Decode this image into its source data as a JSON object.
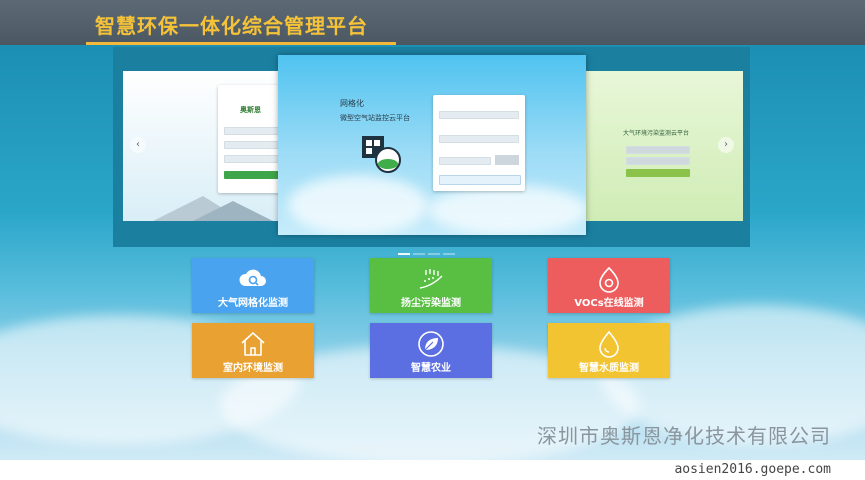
{
  "header": {
    "title": "智慧环保一体化综合管理平台"
  },
  "carousel": {
    "left_slide": {
      "brand": "奥斯恩"
    },
    "center_slide": {
      "title_line1": "网格化",
      "title_line2": "微型空气站监控云平台"
    },
    "right_slide": {
      "title": "大气环境污染监测云平台"
    },
    "prev_arrow": "‹",
    "next_arrow": "›"
  },
  "tiles": [
    {
      "label": "大气网格化监测",
      "color": "#4aa3ee",
      "icon": "cloud-search-icon"
    },
    {
      "label": "扬尘污染监测",
      "color": "#58bf43",
      "icon": "dust-icon"
    },
    {
      "label": "VOCs在线监测",
      "color": "#ee5d5d",
      "icon": "voc-drop-icon"
    },
    {
      "label": "室内环境监测",
      "color": "#e9a132",
      "icon": "house-icon"
    },
    {
      "label": "智慧农业",
      "color": "#5b6ee2",
      "icon": "leaf-icon"
    },
    {
      "label": "智慧水质监测",
      "color": "#f3c431",
      "icon": "water-drop-icon"
    }
  ],
  "watermark": {
    "company": "深圳市奥斯恩净化技术有限公司",
    "url": "aosien2016.goepe.com"
  }
}
